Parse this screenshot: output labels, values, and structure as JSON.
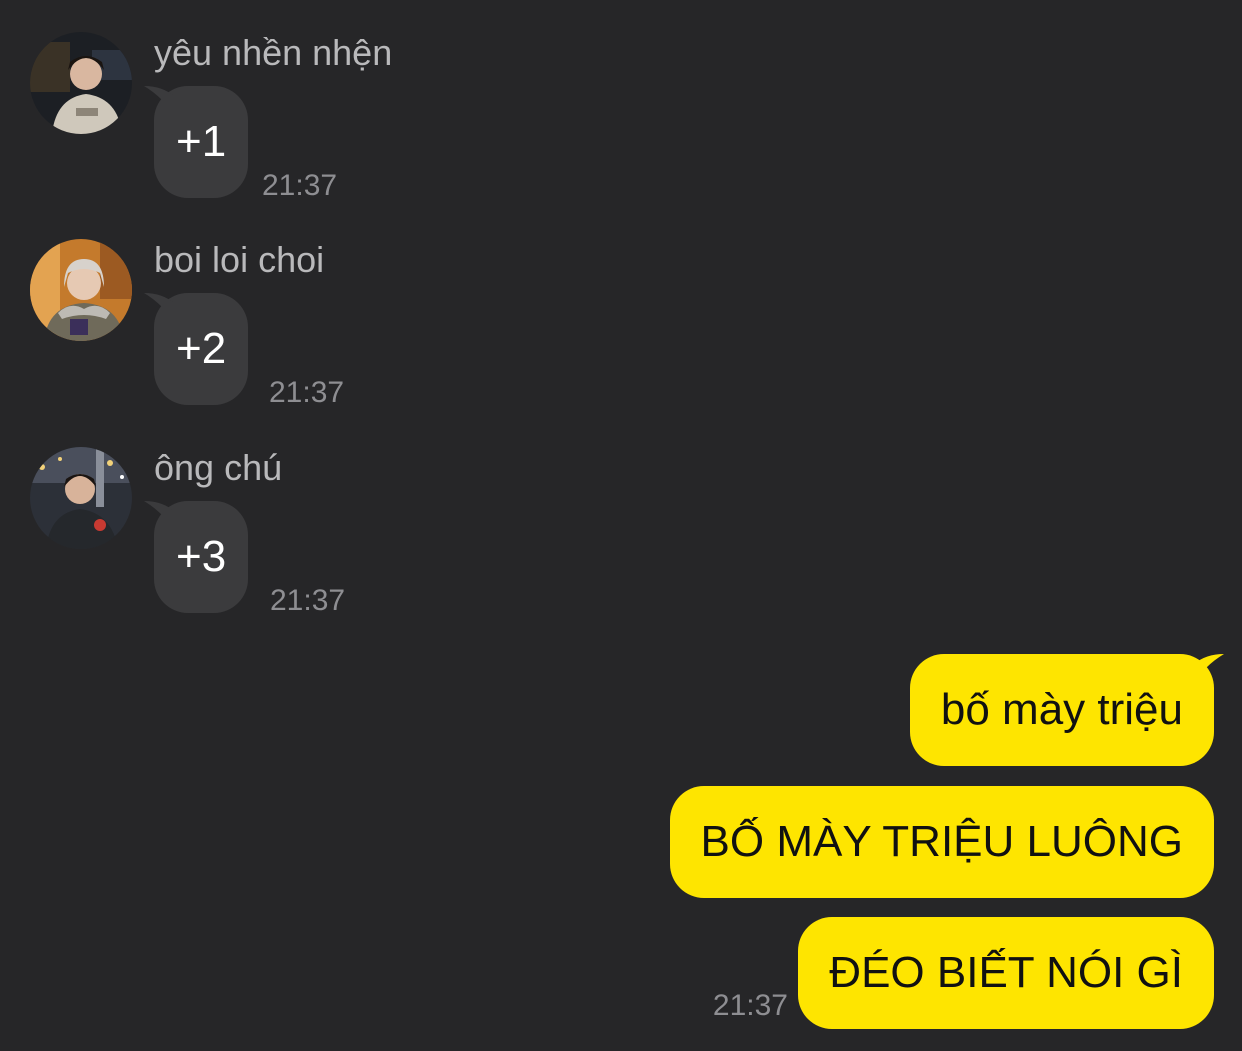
{
  "incoming": [
    {
      "sender": "yêu nhền nhện",
      "text": "+1",
      "time": "21:37",
      "avatar_icon": "user-photo-avatar"
    },
    {
      "sender": "boi loi choi",
      "text": "+2",
      "time": "21:37",
      "avatar_icon": "user-photo-avatar"
    },
    {
      "sender": "ông chú",
      "text": "+3",
      "time": "21:37",
      "avatar_icon": "user-photo-avatar"
    }
  ],
  "outgoing": [
    {
      "text": "bố mày triệu"
    },
    {
      "text": "BỐ MÀY TRIỆU LUÔNG"
    },
    {
      "text": "ĐÉO BIẾT NÓI GÌ"
    }
  ],
  "outgoing_time": "21:37",
  "colors": {
    "background": "#262628",
    "incoming_bubble": "#3b3b3d",
    "outgoing_bubble": "#fee500",
    "timestamp": "#8e8e92",
    "sender_name": "#b9b9bb"
  }
}
